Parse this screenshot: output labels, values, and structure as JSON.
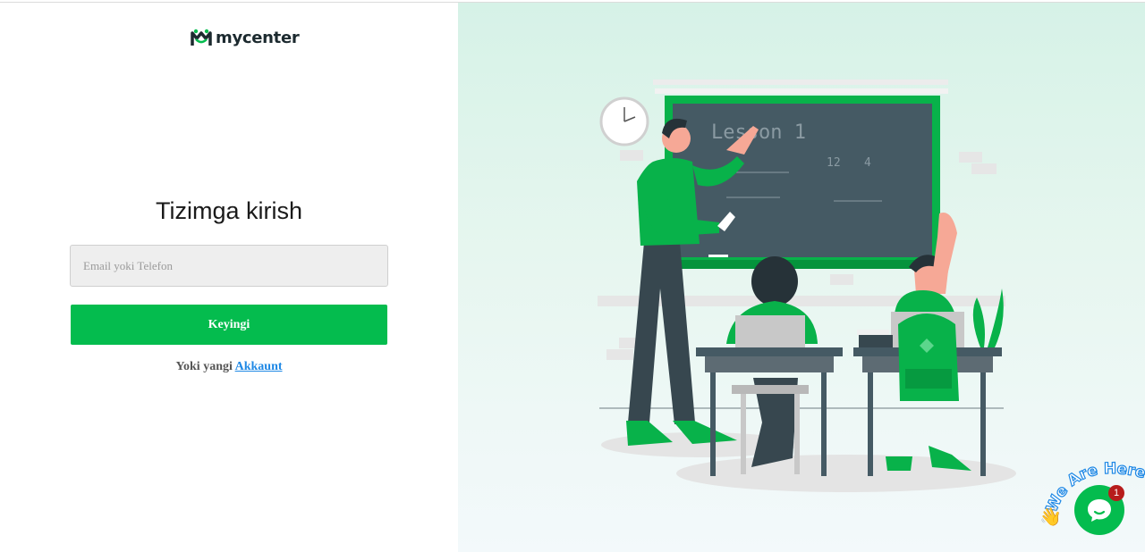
{
  "brand": {
    "name": "mycenter",
    "color": "#04bc4e",
    "dark": "#1c2a2f"
  },
  "login": {
    "title": "Tizimga kirish",
    "email_placeholder": "Email yoki Telefon",
    "email_value": "",
    "next_label": "Keyingi",
    "signup_prefix": "Yoki yangi",
    "signup_link": "Akkaunt"
  },
  "illustration": {
    "icon": "classroom-illustration",
    "board_text": "Lesson 1",
    "board_numbers": [
      "12",
      "4"
    ]
  },
  "chat": {
    "banner_text": "We Are Here!",
    "badge_count": "1",
    "icon": "chat-bubble-icon"
  }
}
